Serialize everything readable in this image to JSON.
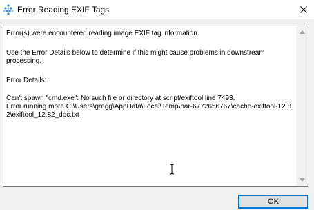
{
  "window": {
    "title": "Error Reading EXIF Tags",
    "app_icon": "exiftool-diamond-icon",
    "close_icon": "close-icon"
  },
  "message": {
    "line1": "Error(s) were encountered reading image EXIF tag information.",
    "line2": "Use the Error Details below to determine if this might cause problems in downstream processing.",
    "line3": "Error Details:",
    "line4": "Can't spawn \"cmd.exe\": No such file or directory at script/exiftool line 7493.",
    "line5": "Error running more C:\\Users\\gregg\\AppData\\Local\\Temp\\par-6772656767\\cache-exiftool-12.82\\exiftool_12.82_doc.txt"
  },
  "buttons": {
    "ok_label": "OK"
  },
  "colors": {
    "accent": "#0078d7",
    "window_bg": "#f0f0f0",
    "content_bg": "#ffffff"
  }
}
